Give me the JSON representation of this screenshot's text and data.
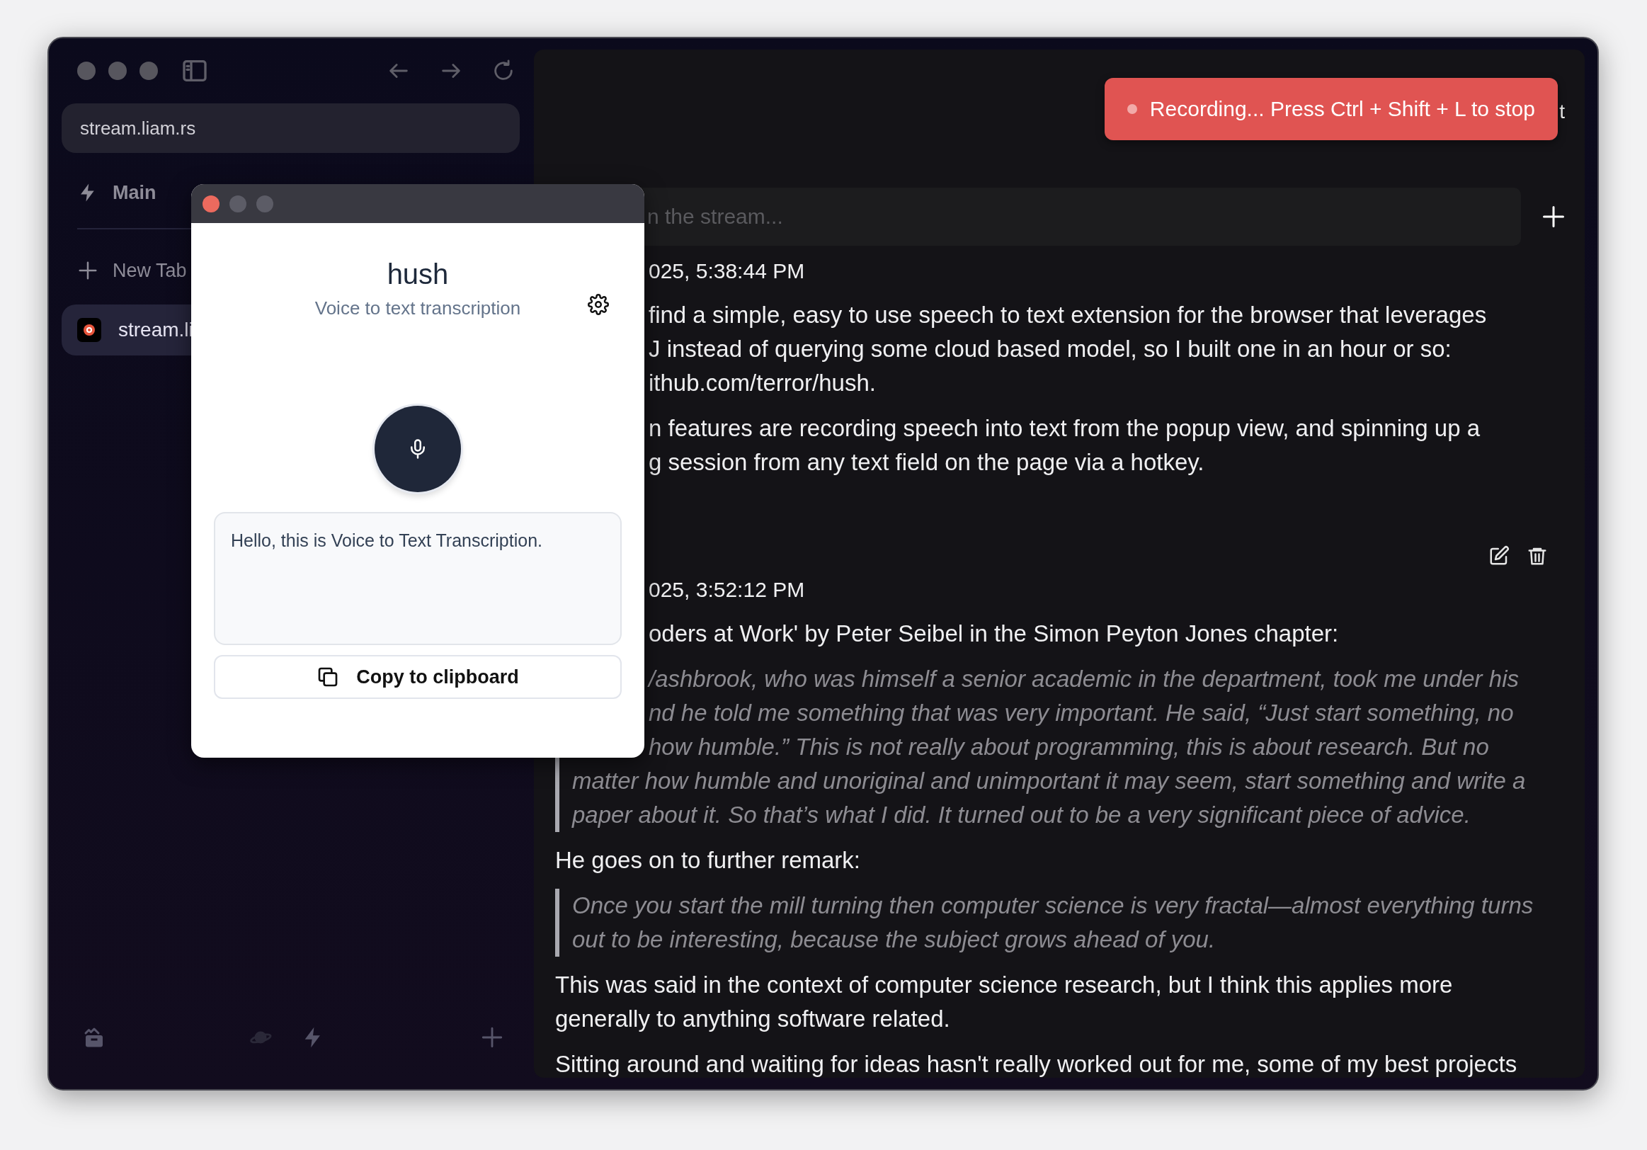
{
  "browser": {
    "url": "stream.liam.rs",
    "pinned": [
      {
        "label": "Main"
      }
    ],
    "new_tab": "New Tab",
    "tabs": [
      {
        "title": "stream.li",
        "selected": true
      }
    ]
  },
  "toast": {
    "text": "Recording... Press Ctrl + Shift + L to stop"
  },
  "header_fragment": "t",
  "search": {
    "placeholder": "n the stream..."
  },
  "entries": [
    {
      "timestamp": "025, 5:38:44 PM",
      "show_actions": false,
      "blocks": [
        {
          "kind": "paragraph",
          "lines": [
            "find a simple, easy to use speech to text extension for the browser that leverages",
            "J instead of querying some cloud based model, so I built one in an hour or so:",
            "ithub.com/terror/hush."
          ]
        },
        {
          "kind": "paragraph",
          "lines": [
            "n features are recording speech into text from the popup view, and spinning up a",
            "g session from any text field on the page via a hotkey."
          ]
        }
      ]
    },
    {
      "timestamp": "025, 3:52:12 PM",
      "show_actions": true,
      "blocks": [
        {
          "kind": "paragraph",
          "lines": [
            "oders at Work' by Peter Seibel in the Simon Peyton Jones chapter:"
          ]
        },
        {
          "kind": "quote",
          "lines": [
            "/ashbrook, who was himself a senior academic in the department, took me under his",
            "nd he told me something that was very important. He said, “Just start something, no",
            "how humble.” This is not really about programming, this is about research. But no",
            "matter how humble and unoriginal and unimportant it may seem, start something and write a",
            "paper about it. So that’s what I did. It turned out to be a very significant piece of advice."
          ]
        },
        {
          "kind": "paragraph",
          "lines": [
            "He goes on to further remark:"
          ]
        },
        {
          "kind": "quote",
          "lines": [
            "Once you start the mill turning then computer science is very fractal—almost everything turns",
            "out to be interesting, because the subject grows ahead of you."
          ]
        },
        {
          "kind": "paragraph",
          "lines": [
            "This was said in the context of computer science research, but I think this applies more",
            "generally to anything software related."
          ]
        },
        {
          "kind": "paragraph",
          "lines": [
            "Sitting around and waiting for ideas hasn't really worked out for me, some of my best projects"
          ]
        }
      ]
    }
  ],
  "popup": {
    "title": "hush",
    "subtitle": "Voice to text transcription",
    "transcript": "Hello, this is Voice to Text Transcription.",
    "copy_button": "Copy to clipboard"
  }
}
